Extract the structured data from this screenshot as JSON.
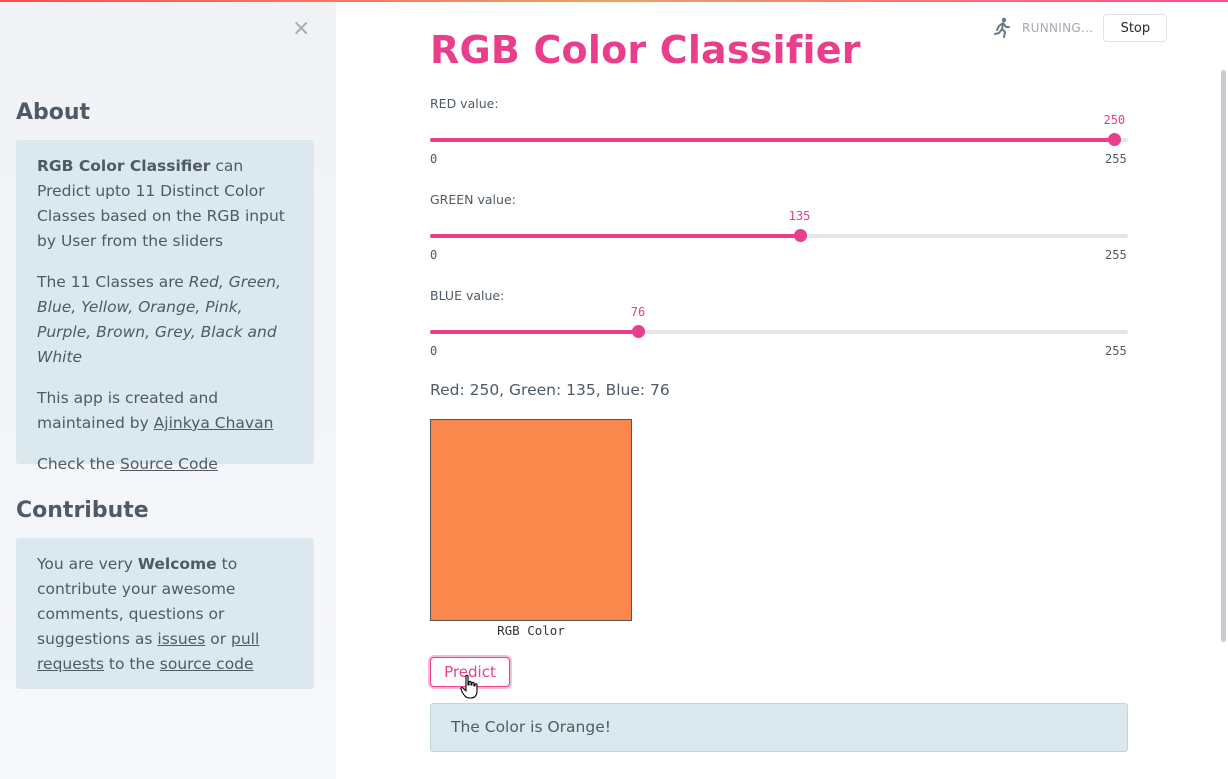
{
  "sidebar": {
    "close_label": "×",
    "about_heading": "About",
    "about": {
      "p1_bold": "RGB Color Classifier",
      "p1_rest": " can Predict upto 11 Distinct Color Classes based on the RGB input by User from the sliders",
      "p2_lead": "The 11 Classes are ",
      "p2_italic": "Red, Green, Blue, Yellow, Orange, Pink, Purple, Brown, Grey, Black and White",
      "p3_lead": "This app is created and maintained by ",
      "p3_link": "Ajinkya Chavan",
      "p4_lead": "Check the ",
      "p4_link": "Source Code"
    },
    "contribute_heading": "Contribute",
    "contribute": {
      "t1": "You are very ",
      "t1_bold": "Welcome",
      "t2": " to contribute your awesome comments, questions or suggestions as ",
      "link_issues": "issues",
      "t3": " or ",
      "link_pull": "pull requests",
      "t4": " to the ",
      "link_source": "source code"
    }
  },
  "header": {
    "status_text": "RUNNING...",
    "stop_label": "Stop"
  },
  "main": {
    "title": "RGB Color Classifier",
    "sliders": [
      {
        "label": "RED value:",
        "value": 250,
        "min": 0,
        "max": 255
      },
      {
        "label": "GREEN value:",
        "value": 135,
        "min": 0,
        "max": 255
      },
      {
        "label": "BLUE value:",
        "value": 76,
        "min": 0,
        "max": 255
      }
    ],
    "rgb_summary": "Red: 250, Green: 135, Blue: 76",
    "swatch_color": "#fa874c",
    "swatch_caption": "RGB Color",
    "predict_label": "Predict",
    "result_text": "The Color is Orange!"
  },
  "colors": {
    "accent": "#e83e8c",
    "info_bg": "#dbe9ee"
  }
}
